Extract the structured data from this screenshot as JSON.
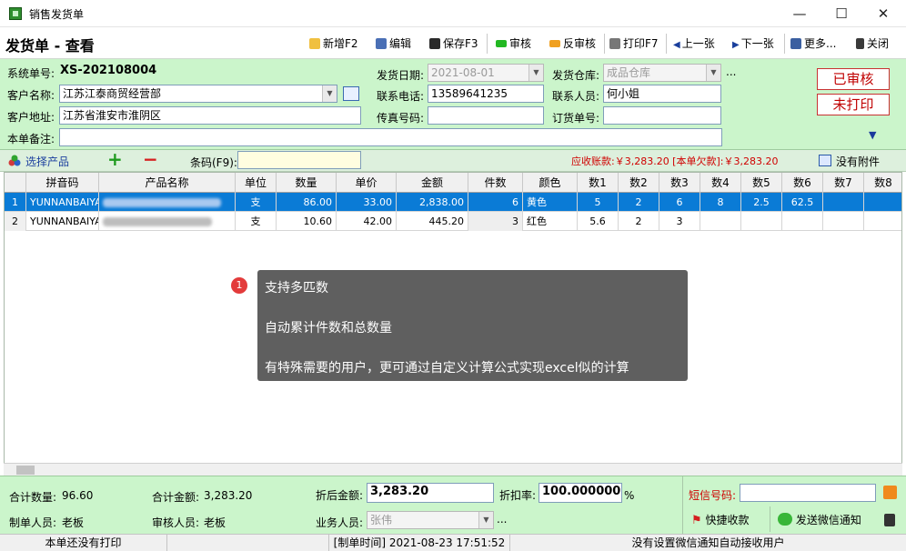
{
  "window": {
    "title": "销售发货单",
    "minimize": "—",
    "maximize": "☐",
    "close": "✕"
  },
  "toolbar": {
    "page_title": "发货单 - 查看",
    "buttons": {
      "new": "新增F2",
      "edit": "编辑",
      "save": "保存F3",
      "approve": "审核",
      "unapprove": "反审核",
      "print": "打印F7",
      "prev": "上一张",
      "next": "下一张",
      "more": "更多...",
      "close": "关闭"
    }
  },
  "form": {
    "order_no_label": "系统单号:",
    "order_no": "XS-202108004",
    "customer_label": "客户名称:",
    "customer": "江苏江泰商贸经营部",
    "address_label": "客户地址:",
    "address": "江苏省淮安市淮阴区",
    "remark_label": "本单备注:",
    "remark": "",
    "ship_date_label": "发货日期:",
    "ship_date": "2021-08-01",
    "phone_label": "联系电话:",
    "phone": "13589641235",
    "fax_label": "传真号码:",
    "fax": "",
    "warehouse_label": "发货仓库:",
    "warehouse": "成品仓库",
    "warehouse_more": "...",
    "contact_label": "联系人员:",
    "contact": "何小姐",
    "order_ref_label": "订货单号:",
    "order_ref": "",
    "stamp_approved": "已审核",
    "stamp_unprinted": "未打印"
  },
  "product_bar": {
    "select_label": "选择产品",
    "add": "+",
    "remove": "−",
    "barcode_label": "条码(F9):",
    "barcode": "",
    "receivable": "应收账款:￥3,283.20 [本单欠款]:￥3,283.20",
    "attachment": "没有附件"
  },
  "table": {
    "headers": [
      "",
      "拼音码",
      "产品名称",
      "单位",
      "数量",
      "单价",
      "金额",
      "件数",
      "颜色",
      "数1",
      "数2",
      "数3",
      "数4",
      "数5",
      "数6",
      "数7",
      "数8"
    ],
    "rows": [
      [
        "1",
        "YUNNANBAIYA",
        "",
        "支",
        "86.00",
        "33.00",
        "2,838.00",
        "6",
        "黄色",
        "5",
        "2",
        "6",
        "8",
        "2.5",
        "62.5",
        "",
        ""
      ],
      [
        "2",
        "YUNNANBAIYA",
        "",
        "支",
        "10.60",
        "42.00",
        "445.20",
        "3",
        "红色",
        "5.6",
        "2",
        "3",
        "",
        "",
        "",
        "",
        ""
      ]
    ]
  },
  "tooltip": {
    "badge": "1",
    "lines": [
      "支持多匹数",
      "自动累计件数和总数量",
      "有特殊需要的用户，更可通过自定义计算公式实现excel似的计算"
    ]
  },
  "footer": {
    "total_qty_label": "合计数量:",
    "total_qty": "96.60",
    "total_amount_label": "合计金额:",
    "total_amount": "3,283.20",
    "discount_amount_label": "折后金额:",
    "discount_amount": "3,283.20",
    "discount_rate_label": "折扣率:",
    "discount_rate": "100.000000",
    "percent": "%",
    "sms_label": "短信号码:",
    "sms": "",
    "creator_label": "制单人员:",
    "creator": "老板",
    "reviewer_label": "审核人员:",
    "reviewer": "老板",
    "sales_label": "业务人员:",
    "sales": "张伟",
    "sales_more": "...",
    "quick_pay": "快捷收款",
    "send_wechat": "发送微信通知"
  },
  "status": {
    "print_state": "本单还没有打印",
    "created_time": "[制单时间] 2021-08-23 17:51:52",
    "wechat_state": "没有设置微信通知自动接收用户"
  },
  "colors": {
    "form_bg": "#cbf5cb",
    "selected_row": "#0a7bd6",
    "stamp_red": "#c00000",
    "money_red": "#d00000"
  }
}
